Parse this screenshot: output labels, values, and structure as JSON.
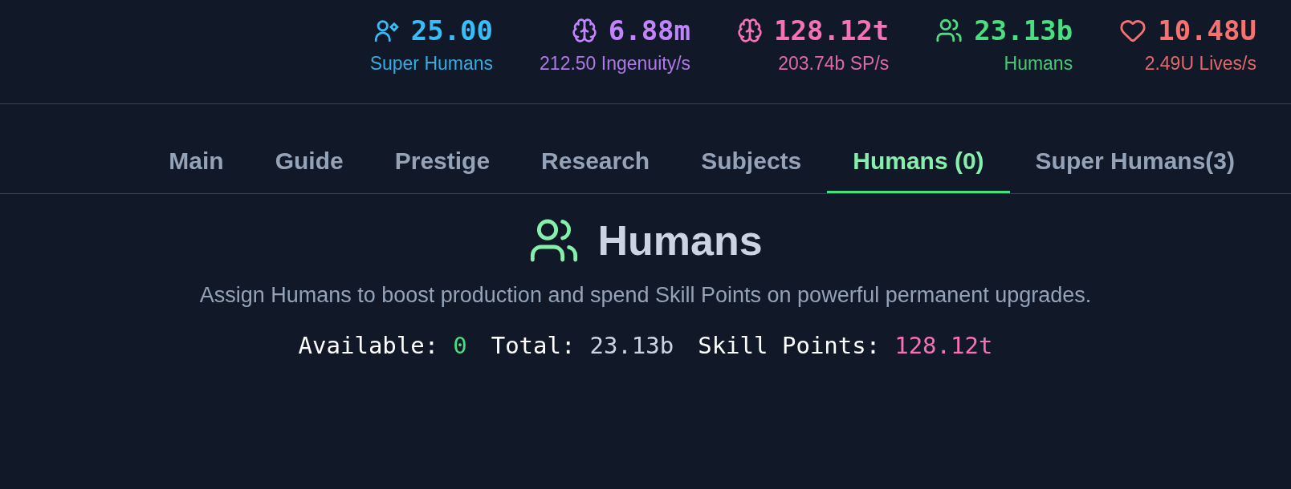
{
  "stats": [
    {
      "kind": "super-humans",
      "value": "25.00",
      "label": "Super Humans",
      "color": "#38bdf8"
    },
    {
      "kind": "brain",
      "value": "6.88m",
      "label": "212.50 Ingenuity/s",
      "color": "#c084fc"
    },
    {
      "kind": "brain",
      "value": "128.12t",
      "label": "203.74b SP/s",
      "color": "#f472b6"
    },
    {
      "kind": "humans",
      "value": "23.13b",
      "label": "Humans",
      "color": "#4ade80"
    },
    {
      "kind": "heart",
      "value": "10.48U",
      "label": "2.49U Lives/s",
      "color": "#f87171"
    }
  ],
  "tabs": [
    {
      "label": "Main",
      "selected": false
    },
    {
      "label": "Guide",
      "selected": false
    },
    {
      "label": "Prestige",
      "selected": false
    },
    {
      "label": "Research",
      "selected": false
    },
    {
      "label": "Subjects",
      "selected": false
    },
    {
      "label": "Humans (0)",
      "selected": true
    },
    {
      "label": "Super Humans(3)",
      "selected": false
    }
  ],
  "section": {
    "title": "Humans",
    "description": "Assign Humans to boost production and spend Skill Points on powerful permanent upgrades.",
    "summary": [
      {
        "label": "Available:",
        "value": "0",
        "color": "#4ade80"
      },
      {
        "label": "Total:",
        "value": "23.13b",
        "color": "#cbd5e1"
      },
      {
        "label": "Skill Points:",
        "value": "128.12t",
        "color": "#f472b6"
      }
    ]
  }
}
